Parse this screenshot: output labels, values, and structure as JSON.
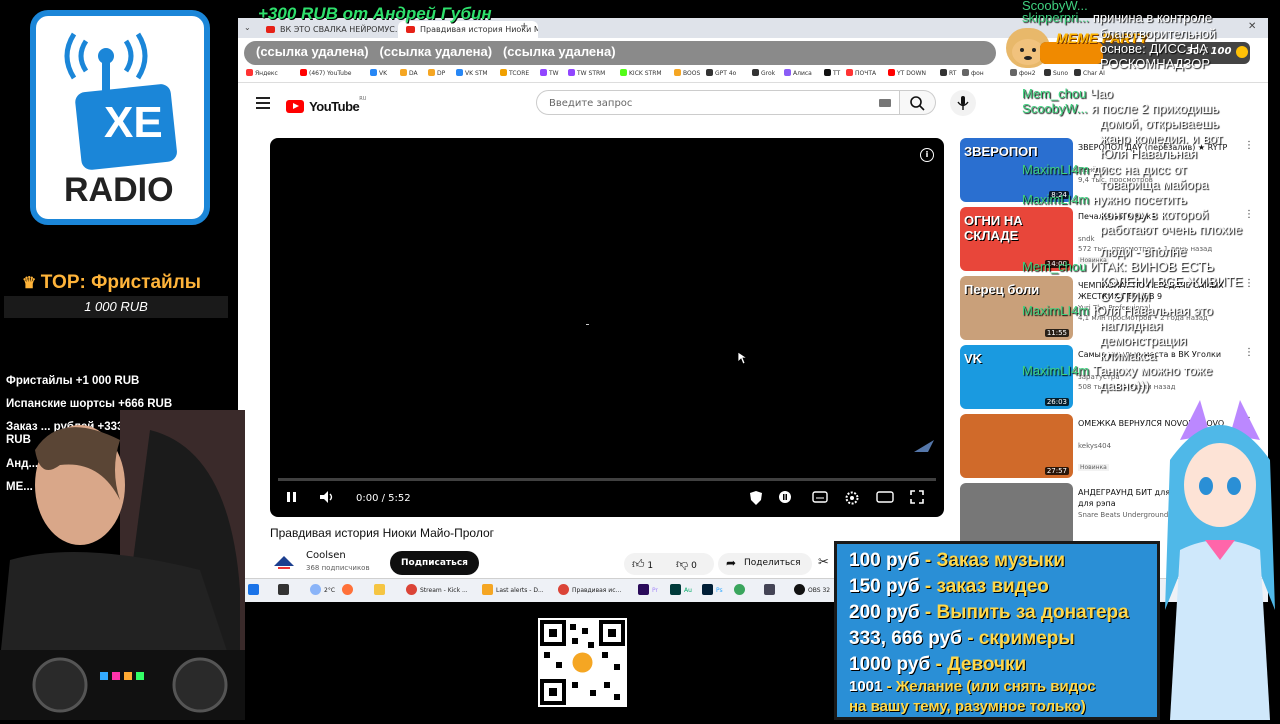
{
  "browser": {
    "tabs": [
      {
        "label": "ВК ЭТО СВАЛКА НЕЙРОМУС..."
      },
      {
        "label": "Правдивая история Ниоки М..."
      }
    ],
    "bookmarks": [
      "Яндекс",
      "(467) YouTube",
      "VK",
      "DA",
      "DP",
      "VK STM",
      "TCORE",
      "TW",
      "TW STRM",
      "KICK STRM",
      "BOOS",
      "GPT 4o",
      "Grok",
      "Алиса",
      "TT",
      "ПОЧТА",
      "YT DOWN",
      "RT",
      "фон",
      "фон2",
      "Suno",
      "Char AI"
    ]
  },
  "youtube": {
    "logo_text": "YouTube",
    "logo_region": "RU",
    "search_placeholder": "Введите запрос",
    "video_time": "0:00 / 5:52",
    "progress_fraction": 0.0,
    "video_title": "Правдивая история Ниоки Майо-Пролог",
    "channel_name": "Coolsen",
    "channel_subs": "368 подписчиков",
    "subscribe_label": "Подписаться",
    "like_count": "1",
    "dislike_count": "0",
    "share_label": "Поделиться",
    "sidebar": [
      {
        "title": "ЗВЕРОПОЛ ДАУ (перезалив) ★ RYTP",
        "channel": "Пенёк Т...",
        "meta": "9,4 тыс. просмотров",
        "duration": "8:24",
        "badge": "",
        "color": "#2a6fd0",
        "thumb_text": "ЗВЕРОПОП"
      },
      {
        "title": "Печальный мишка",
        "channel": "sndk",
        "meta": "572 тыс. просмотров • 1 день назад",
        "duration": "14:00",
        "badge": "Новинка",
        "color": "#e8463a",
        "thumb_text": "ОГНИ НА СКЛАДЕ"
      },
      {
        "title": "ЧЕМПИОНАТ ПО ПЕРЕДАЧЕ САМЫХ ЖЕСТКИХ ПЕРЦЕВ 9",
        "channel": "Yuri The Professional",
        "meta": "4,1 млн просмотров • 2 года назад",
        "duration": "11:55",
        "badge": "",
        "color": "#c9a07a",
        "thumb_text": "Перец боли"
      },
      {
        "title": "Самые унылые места в ВК Уголки",
        "channel": "заратустра",
        "meta": "508 тыс. • 2 недели назад",
        "duration": "26:03",
        "badge": "",
        "color": "#1a9ae0",
        "thumb_text": "VK"
      },
      {
        "title": "ОМЕЖКА ВЕРНУЛСЯ NOVOE OLOVO",
        "channel": "kekys404",
        "meta": "",
        "duration": "27:57",
        "badge": "Новинка",
        "color": "#d06a2a",
        "thumb_text": ""
      },
      {
        "title": "АНДЕГРАУНД БИТ для рэпа | Бит для рэпа",
        "channel": "Snare Beats Underground",
        "meta": "",
        "duration": "",
        "badge": "",
        "color": "#777777",
        "thumb_text": ""
      }
    ]
  },
  "taskbar": {
    "weather": "2°C",
    "apps": [
      "Stream - Kick ...",
      "Last alerts - D...",
      "Правдивая ис...",
      "Pr",
      "Au",
      "Ps",
      "OBS 32"
    ]
  },
  "overlay": {
    "donation_top": "+300 RUB  от Андрей Губин",
    "links": [
      "(ссылка удалена)",
      "(ссылка удалена)",
      "(ссылка удалена)"
    ],
    "meme_title": "MEME PARTY",
    "meme_count": "30 / 100",
    "meme_progress_fraction": 0.3,
    "radio_text": "RADIO",
    "radio_logo": "XE",
    "top_title": "TOP: Фристайлы",
    "top_amount": "1 000 RUB",
    "donors": [
      "Фристайлы +1 000 RUB",
      "Испанские шортсы +666 RUB",
      "Заказ ... рублей +333",
      "RUB",
      "Анд...",
      "МЕ..."
    ],
    "chat": [
      {
        "user": "ScoobyW...",
        "text": ""
      },
      {
        "user": "skipperpri...",
        "text": "причина в контроле"
      },
      {
        "user": "",
        "text": "благотворительной"
      },
      {
        "user": "",
        "text": "основе: ДИСС НА"
      },
      {
        "user": "",
        "text": "РОСКОМНАДЗОР"
      },
      {
        "user": "Mem_chou",
        "text": "Чао"
      },
      {
        "user": "ScoobyW...",
        "text": "я после 2 приходишь"
      },
      {
        "user": "",
        "text": "домой, открываешь"
      },
      {
        "user": "",
        "text": "жанр комедия. и вот"
      },
      {
        "user": "",
        "text": "Юля Навальная"
      },
      {
        "user": "MaximLI4m",
        "text": "дисс на дисс от"
      },
      {
        "user": "",
        "text": "товарища майора"
      },
      {
        "user": "MaximLI4m",
        "text": "нужно посетить"
      },
      {
        "user": "",
        "text": "контору в которой"
      },
      {
        "user": "",
        "text": "работают очень плохие"
      },
      {
        "user": "",
        "text": "люди - вполне"
      },
      {
        "user": "Mem_chou",
        "text": "ИТАК: ВИНОВ ЕСТЬ"
      },
      {
        "user": "",
        "text": "КОЛЕНИ ВСЕ ЖИВИТЕ"
      },
      {
        "user": "",
        "text": "С ЭТИМ"
      },
      {
        "user": "MaximLI4m",
        "text": "Юля Навальная это"
      },
      {
        "user": "",
        "text": "наглядная"
      },
      {
        "user": "",
        "text": "демонстрация"
      },
      {
        "user": "",
        "text": "климакса"
      },
      {
        "user": "MaximLI4m",
        "text": "Танюху можно тоже"
      },
      {
        "user": "",
        "text": "давно)))"
      }
    ],
    "prices": [
      {
        "amount": "100 руб",
        "desc": "- Заказ музыки"
      },
      {
        "amount": "150 руб",
        "desc": "- заказ видео"
      },
      {
        "amount": "200 руб",
        "desc": "- Выпить за донатера"
      },
      {
        "amount": "333, 666 руб",
        "desc": "- скримеры"
      },
      {
        "amount": "1000 руб",
        "desc": "- Девочки"
      },
      {
        "amount": "1001",
        "desc": "- Желание (или снять видос"
      },
      {
        "amount": "",
        "desc": "на вашу тему, разумное только)"
      }
    ]
  }
}
